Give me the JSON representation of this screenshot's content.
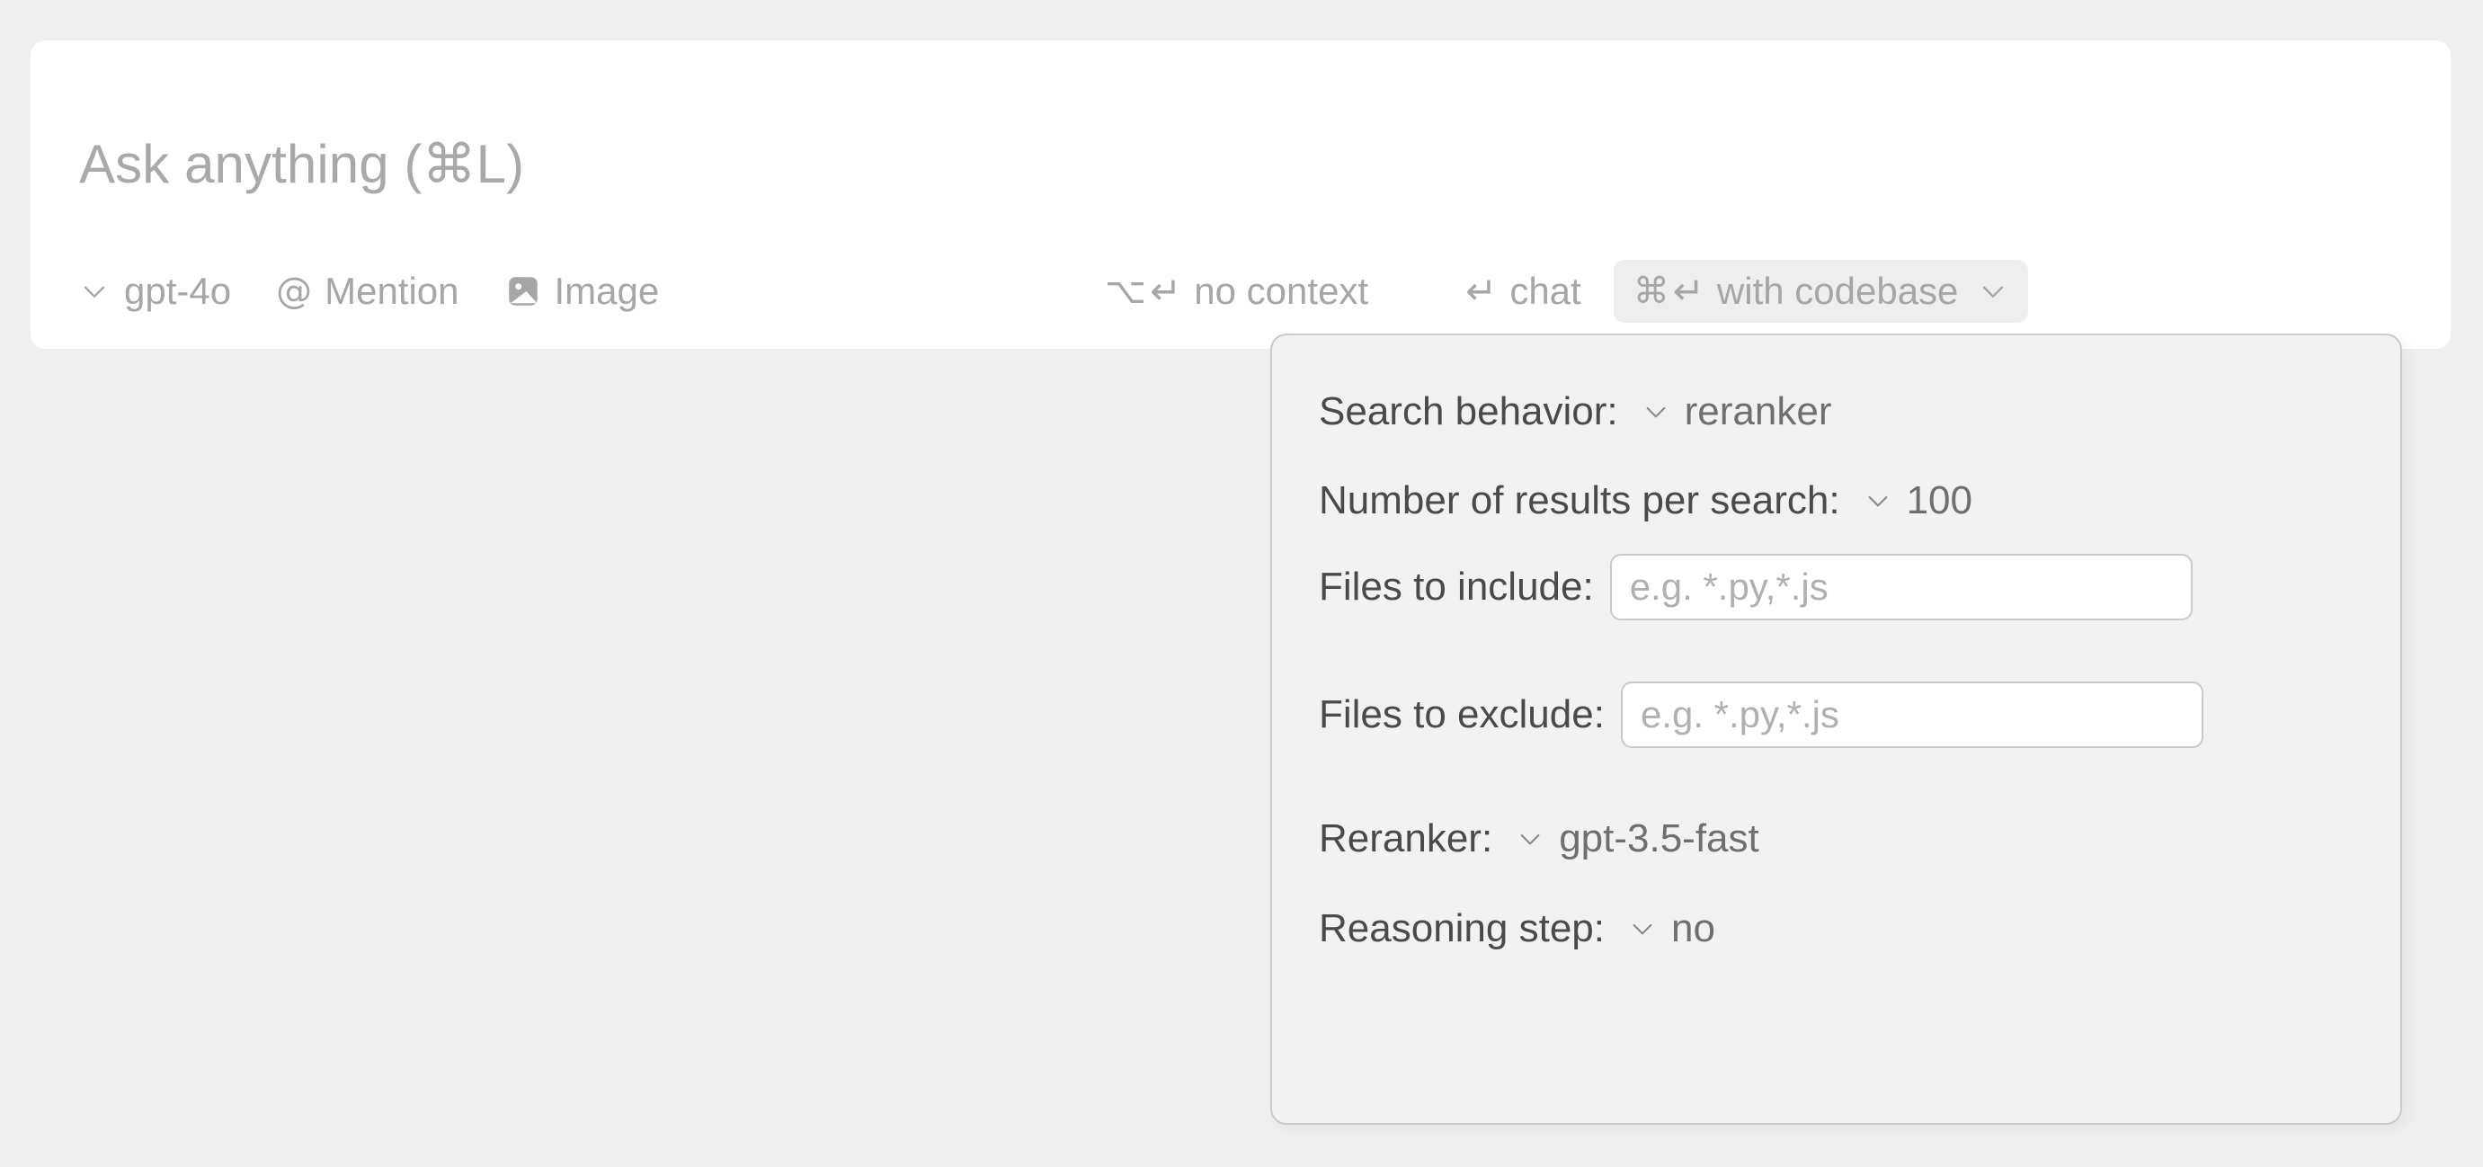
{
  "composer": {
    "prompt_placeholder": "Ask anything (⌘L)",
    "toolbar": {
      "model_selector": {
        "icon": "chevron-down-icon",
        "label": "gpt-4o"
      },
      "mention": {
        "icon": "at-sign-icon",
        "label": "Mention"
      },
      "image": {
        "icon": "image-icon",
        "label": "Image"
      },
      "no_context": {
        "keys": [
          "⌥",
          "↩"
        ],
        "label": "no context"
      },
      "chat": {
        "keys": [
          "↩"
        ],
        "label": "chat"
      },
      "with_codebase": {
        "keys": [
          "⌘",
          "↩"
        ],
        "label": "with codebase",
        "chevron": "chevron-down-icon",
        "active": true,
        "pill_color": "#eeeeee"
      }
    }
  },
  "codebase_options_panel": {
    "rows": [
      {
        "id": "search-behavior",
        "label": "Search behavior:",
        "type": "select",
        "value": "reranker"
      },
      {
        "id": "results-count",
        "label": "Number of results per search:",
        "type": "select",
        "value": "100"
      },
      {
        "id": "files-include",
        "label": "Files to include:",
        "type": "text",
        "value": "",
        "placeholder": "e.g. *.py,*.js"
      },
      {
        "id": "files-exclude",
        "label": "Files to exclude:",
        "type": "text",
        "value": "",
        "placeholder": "e.g. *.py,*.js"
      },
      {
        "id": "reranker",
        "label": "Reranker:",
        "type": "select",
        "value": "gpt-3.5-fast"
      },
      {
        "id": "reasoning-step",
        "label": "Reasoning step:",
        "type": "select",
        "value": "no"
      }
    ]
  },
  "colors": {
    "page_background": "#efefef",
    "card_background": "#ffffff",
    "panel_background": "#f2f2f2",
    "panel_border": "#c9c9c9",
    "muted_text": "#a6a6a6",
    "label_text": "#4a4a4a",
    "value_text": "#6f6f6f",
    "placeholder_text": "#b0b0b0"
  }
}
